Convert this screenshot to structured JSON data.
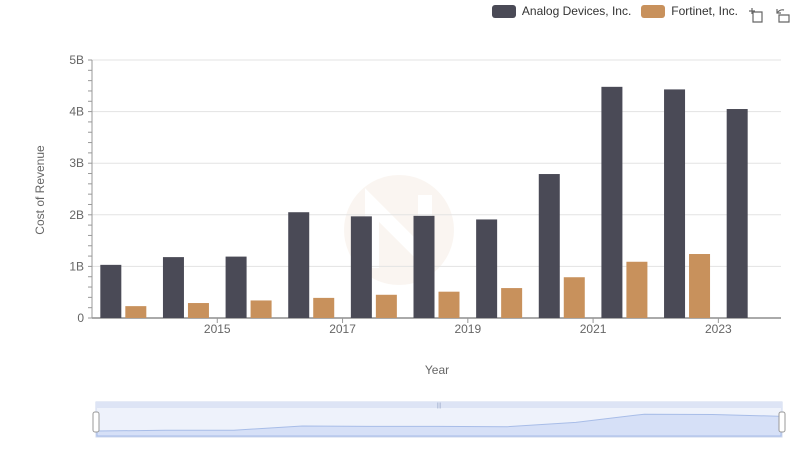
{
  "toolbar": {
    "zoom_icon": "zoom-select-icon",
    "reset_icon": "zoom-reset-icon"
  },
  "chart_data": {
    "type": "bar",
    "xlabel": "Year",
    "ylabel": "Cost of Revenue",
    "ylim": [
      0,
      5000000000
    ],
    "yticks": [
      "0",
      "1B",
      "2B",
      "3B",
      "4B",
      "5B"
    ],
    "xticks": [
      "2015",
      "2017",
      "2019",
      "2021",
      "2023"
    ],
    "categories": [
      "2014",
      "2015",
      "2016",
      "2017",
      "2018",
      "2019",
      "2020",
      "2021",
      "2022",
      "2023",
      "2024"
    ],
    "series": [
      {
        "name": "Analog Devices, Inc.",
        "color": "#4a4a56",
        "values": [
          1030000000,
          1180000000,
          1190000000,
          2050000000,
          1970000000,
          1980000000,
          1910000000,
          2790000000,
          4480000000,
          4430000000,
          4050000000
        ]
      },
      {
        "name": "Fortinet, Inc.",
        "color": "#c8915c",
        "values": [
          230000000,
          290000000,
          340000000,
          390000000,
          450000000,
          510000000,
          580000000,
          790000000,
          1090000000,
          1240000000,
          null
        ]
      }
    ],
    "legend": "top-right",
    "grid": true
  }
}
